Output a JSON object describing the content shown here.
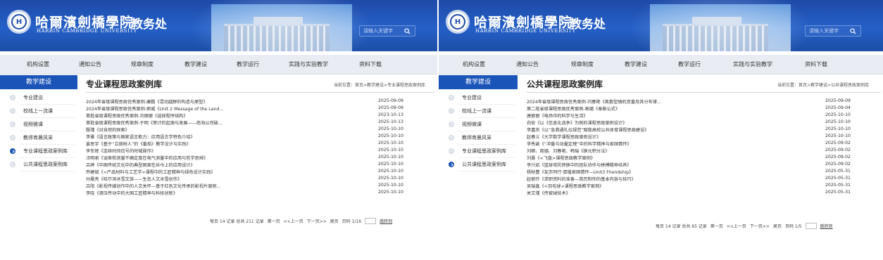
{
  "header": {
    "uni_name": "哈爾濱劍橋學院",
    "uni_en": "HARBIN CAMBRIDGE UNIVERSITY",
    "dept": "教务处",
    "search_placeholder": "请输入关键字",
    "logo_glyph": "H"
  },
  "nav": [
    "机构设置",
    "通知公告",
    "规章制度",
    "教学建设",
    "教学运行",
    "实践与实验教学",
    "资料下载"
  ],
  "sidebar": {
    "title": "教学建设",
    "items": [
      "专业建设",
      "校线上一流课",
      "视频微课",
      "教师育晨风采",
      "专业课程思政案例库",
      "公共课程思政案例库"
    ]
  },
  "left": {
    "title": "专业课程思政案例库",
    "breadcrumb": "当前位置：首页>教学建设>专业课程思政案例库",
    "active_index": 4,
    "rows": [
      {
        "title": "2024年省级课程思政优秀案例-康鹏《混动越野的构造与原型》",
        "date": "2025-09-09"
      },
      {
        "title": "2024年省级课程思政优秀案例-郭威《Unit 2 Message of the Land...",
        "date": "2025-09-09"
      },
      {
        "title": "首批省级课程思政优秀案例-刘丽娜《选择程序结构》",
        "date": "2023-10-13"
      },
      {
        "title": "首批省级课程思政优秀案例-于明《审计的起源与发展——南海公司破...",
        "date": "2025-10-13"
      },
      {
        "title": "殷瑾《对自然的探索》",
        "date": "2025-10-10"
      },
      {
        "title": "李雅《语言政策与国家语言能力：应用语言学特色介绍》",
        "date": "2025-10-10"
      },
      {
        "title": "姜思宇《基于“立德树人”的《番茄》教学设计与实践》",
        "date": "2025-10-10"
      },
      {
        "title": "李东辉《连续时间信号的时域操作》",
        "date": "2025-10-10"
      },
      {
        "title": "汪明君《误差和测量不确定度在电气测量中的应用与哲学思辨》",
        "date": "2025-10-10"
      },
      {
        "title": "吕婷《中国传统文化中的典型图案在丝巾上的应用设计》",
        "date": "2025-10-10"
      },
      {
        "title": "乔建斌《<产品材料与工艺学>课程中的工匠精神与绿色设计实践》",
        "date": "2025-10-10"
      },
      {
        "title": "孙晨亮《哈尔滨冰雪文旅——生态人文冰雪创作》",
        "date": "2025-10-10"
      },
      {
        "title": "吕阳《影视传媒创作中的人文关怀—基于红色文化传承的影视片案例...",
        "date": "2025-10-10"
      },
      {
        "title": "李晓《液压传动中的大国工匠精神与科技创新》",
        "date": "2025-10-10"
      }
    ],
    "pager": {
      "total": "每页 14 记录  总共 211 记录",
      "first": "第一页",
      "prev": "<<上一页",
      "next": "下一页>>",
      "last": "尾页",
      "page": "页码 1/16",
      "go": "跳转到"
    }
  },
  "right": {
    "title": "公共课程思政案例库",
    "breadcrumb": "当前位置：首页>教学建设>公共课程思政案例库",
    "active_index": 5,
    "rows": [
      {
        "title": "2024年省级课程思政优秀案例-刘春艳《离散型随机变量及其分布律...",
        "date": "2025-09-09"
      },
      {
        "title": "第二批省级课程思政优秀案例-高璐《泰勒公式》",
        "date": "2025-09-04"
      },
      {
        "title": "唐丽丽《电场中的科学与生活》",
        "date": "2025-10-10"
      },
      {
        "title": "白宏《以《信息化战争》为例的课程思政案例设计》",
        "date": "2025-10-10"
      },
      {
        "title": "李嘉庆《以“急救通礼仪规范”赋能高校公共体育课程思政建设》",
        "date": "2025-10-10"
      },
      {
        "title": "赵春义《大学数学课程思政案例设计》",
        "date": "2025-10-10"
      },
      {
        "title": "李秀颖《“冲量与动量定理”中的科学精神与家国情怀》",
        "date": "2025-09-02"
      },
      {
        "title": "刘卿、周璐、刘春艳、韩瑞《换元积分法》",
        "date": "2025-09-02"
      },
      {
        "title": "刘晨《<飞盘>课程思政教学案例》",
        "date": "2025-09-02"
      },
      {
        "title": "李兴凯《篮球攻防转换中的团队协作与拼搏精神培养》",
        "date": "2025-09-02"
      },
      {
        "title": "杨秋蕾《友亦同行·厚植家国情怀—Unit3 Friendship》",
        "date": "2025-05-31"
      },
      {
        "title": "赵丽玲《求职资料的准备—简历制作的基本内容与技巧》",
        "date": "2025-05-31"
      },
      {
        "title": "吴瑞鑫《<羽毛球>课程思政教学案例》",
        "date": "2025-05-31"
      },
      {
        "title": "关文瑾《传被球技术》",
        "date": "2025-05-31"
      }
    ],
    "pager": {
      "total": "每页 14 记录  总共 65 记录",
      "first": "第一页",
      "prev": "<<上一页",
      "next": "下一页>>",
      "last": "尾页",
      "page": "页码 1/5",
      "go": "跳转到"
    }
  },
  "colors": {
    "accent": "#1b54b8",
    "banner": "#2560c8",
    "nav_bg": "#e9edf3"
  }
}
